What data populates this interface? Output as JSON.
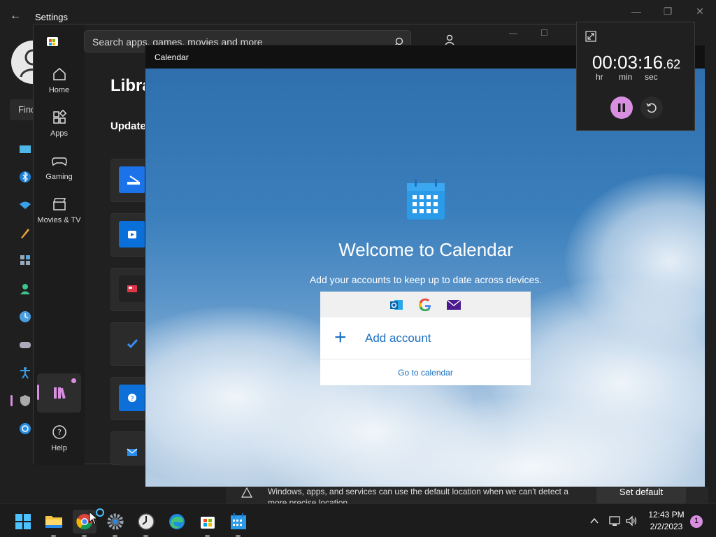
{
  "settings": {
    "title": "Settings",
    "find_text": "Find"
  },
  "store": {
    "search_placeholder": "Search apps, games, movies and more",
    "nav": [
      {
        "label": "Home"
      },
      {
        "label": "Apps"
      },
      {
        "label": "Gaming"
      },
      {
        "label": "Movies & TV"
      },
      {
        "label": "Help"
      }
    ],
    "page_title": "Libra",
    "section_title": "Update"
  },
  "calendar": {
    "window_title": "Calendar",
    "welcome": "Welcome to Calendar",
    "subtitle": "Add your accounts to keep up to date across devices.",
    "add_account": "Add account",
    "go_to_calendar": "Go to calendar",
    "providers": [
      "outlook-icon",
      "google-icon",
      "mail-icon"
    ]
  },
  "location_strip": {
    "text": "Windows, apps, and services can use the default location when we can't detect a more precise location.",
    "button": "Set default"
  },
  "timer": {
    "hh": "00",
    "mm": "03",
    "ss": "16",
    "frac": ".62",
    "label_hr": "hr",
    "label_min": "min",
    "label_sec": "sec",
    "accent": "#d88fe0"
  },
  "taskbar": {
    "time": "12:43 PM",
    "date": "2/2/2023",
    "notifications": "1"
  }
}
